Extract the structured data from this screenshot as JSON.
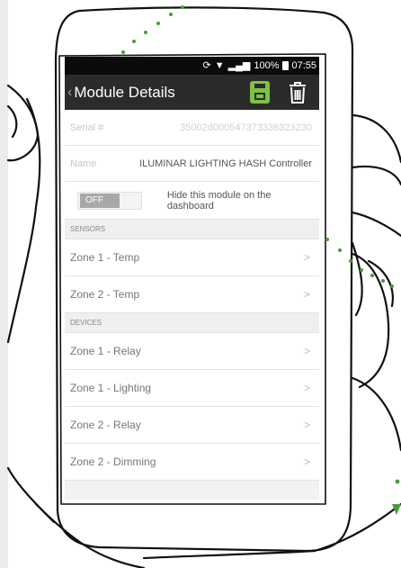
{
  "status_bar": {
    "battery_percent": "100%",
    "time": "07:55",
    "icons": [
      "sync-icon",
      "wifi-icon",
      "signal-icon",
      "battery-icon"
    ]
  },
  "action_bar": {
    "back_glyph": "‹",
    "title": "Module Details",
    "save_icon": "floppy-disk-icon",
    "delete_icon": "trash-icon"
  },
  "details": {
    "serial": {
      "label": "Serial #",
      "value": "35002d000547373336323230"
    },
    "name": {
      "label": "Name",
      "value": "ILUMINAR LIGHTING HASH Controller"
    },
    "toggle": {
      "state_label": "OFF",
      "hint": "Hide this module on the dashboard"
    }
  },
  "sensors": {
    "header": "SENSORS",
    "items": [
      {
        "label": "Zone 1 - Temp"
      },
      {
        "label": "Zone 2 - Temp"
      }
    ]
  },
  "devices": {
    "header": "DEVICES",
    "items": [
      {
        "label": "Zone 1 - Relay"
      },
      {
        "label": "Zone 1 - Lighting"
      },
      {
        "label": "Zone 2 - Relay"
      },
      {
        "label": "Zone 2 - Dimming"
      }
    ]
  },
  "chevron_glyph": ">",
  "colors": {
    "accent_green": "#7dc242",
    "action_bar": "#2b2b2b",
    "status_bar": "#0b0b0b",
    "trail_dots": "#4a9a3a"
  }
}
